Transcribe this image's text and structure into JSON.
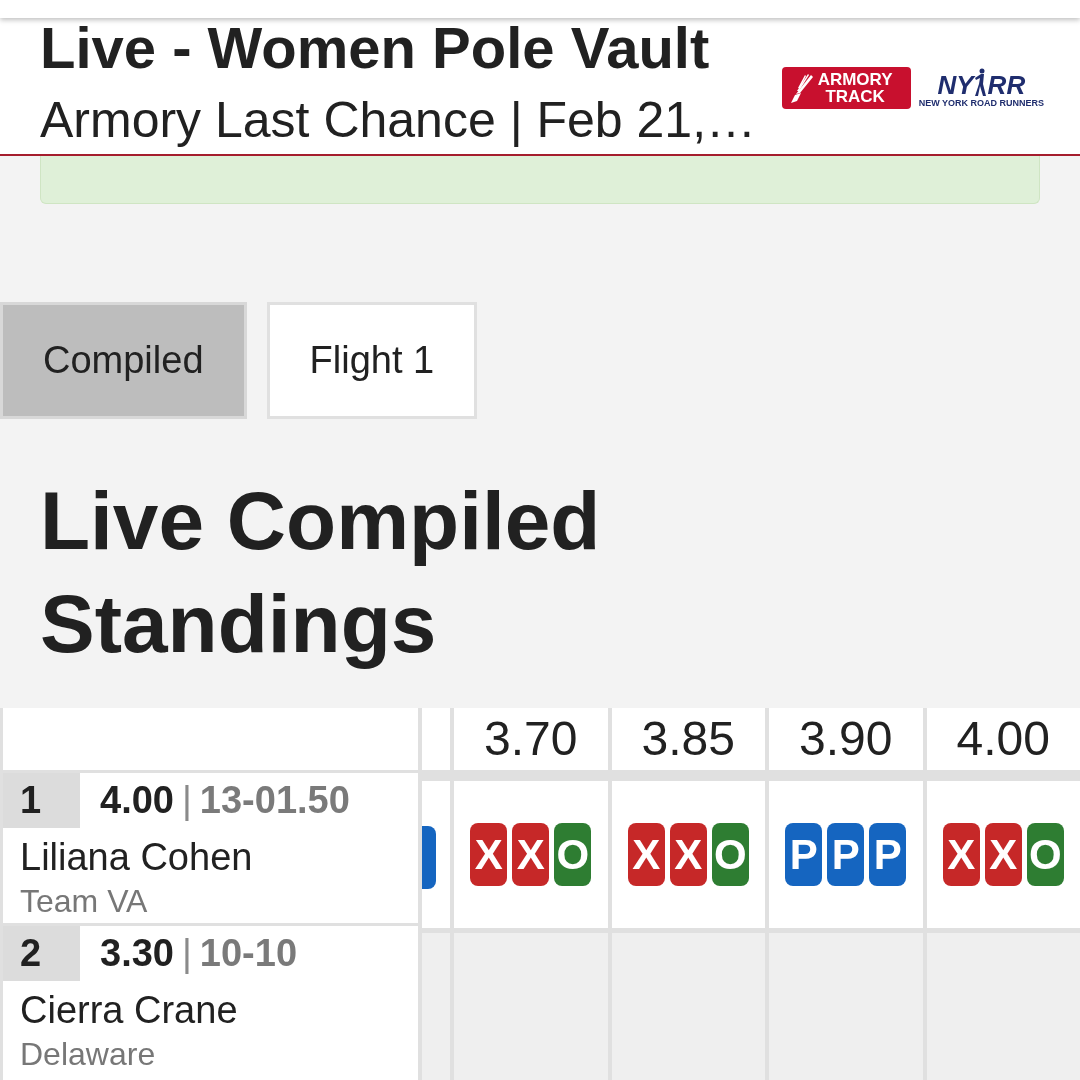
{
  "header": {
    "title": "Live - Women Pole Vault",
    "subtitle": "Armory Last Chance | Feb 21,…",
    "logos": [
      {
        "kind": "armory",
        "lines": [
          "ARMORY",
          "TRACK"
        ]
      },
      {
        "kind": "nyrr",
        "left": "NY",
        "right": "RR",
        "tagline": "NEW YORK ROAD RUNNERS"
      }
    ]
  },
  "tabs": [
    {
      "label": "Compiled",
      "selected": true
    },
    {
      "label": "Flight 1",
      "selected": false
    }
  ],
  "heading": "Live Compiled Standings",
  "table": {
    "heights": [
      "3.70",
      "3.85",
      "3.90",
      "4.00"
    ],
    "cut_column": {
      "attempts": [
        {
          "kind": "pass"
        }
      ]
    },
    "rows": [
      {
        "rank": "1",
        "mark": "4.00",
        "separator": "|",
        "imperial": "13-01.50",
        "name": "Liliana Cohen",
        "team": "Team VA",
        "attempts": [
          [
            {
              "kind": "fail",
              "mark": "X"
            },
            {
              "kind": "fail",
              "mark": "X"
            },
            {
              "kind": "clear",
              "mark": "O"
            }
          ],
          [
            {
              "kind": "fail",
              "mark": "X"
            },
            {
              "kind": "fail",
              "mark": "X"
            },
            {
              "kind": "clear",
              "mark": "O"
            }
          ],
          [
            {
              "kind": "pass",
              "mark": "P"
            },
            {
              "kind": "pass",
              "mark": "P"
            },
            {
              "kind": "pass",
              "mark": "P"
            }
          ],
          [
            {
              "kind": "fail",
              "mark": "X"
            },
            {
              "kind": "fail",
              "mark": "X"
            },
            {
              "kind": "clear",
              "mark": "O"
            }
          ]
        ]
      },
      {
        "rank": "2",
        "mark": "3.30",
        "separator": "|",
        "imperial": "10-10",
        "name": "Cierra Crane",
        "team": "Delaware"
      }
    ]
  }
}
